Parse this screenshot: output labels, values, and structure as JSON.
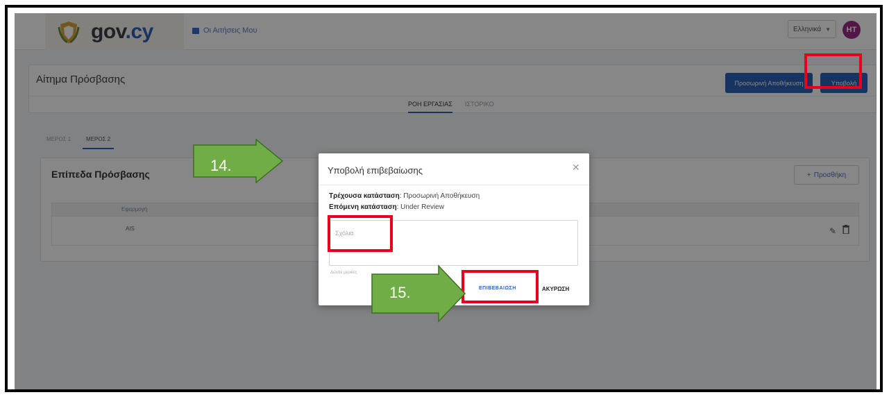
{
  "topnav": {
    "brand": "gov",
    "brand_suffix": ".cy",
    "nav_link": "Οι Αιτήσεις Μου",
    "language": "Ελληνικά",
    "avatar_initials": "HT"
  },
  "page": {
    "title": "Αίτημα Πρόσβασης",
    "save_button": "Προσωρινή Αποθήκευση",
    "submit_button": "Υποβολή",
    "tabs": [
      "ΡΟΗ ΕΡΓΑΣΙΑΣ",
      "ΙΣΤΟΡΙΚΟ"
    ],
    "subtabs": [
      "ΜΕΡΟΣ 1",
      "ΜΕΡΟΣ 2"
    ]
  },
  "access_levels": {
    "title": "Επίπεδα Πρόσβασης",
    "add_button": "Προσθήκη",
    "column_header": "Εφαρμογή",
    "rows": [
      {
        "application": "AIS"
      }
    ]
  },
  "modal": {
    "title": "Υποβολή επιβεβαίωσης",
    "current_state_label": "Τρέχουσα κατάσταση",
    "current_state_value": ": Προσωρινή Αποθήκευση",
    "next_state_label": "Επόμενη κατάσταση",
    "next_state_value": ": Under Review",
    "comments_placeholder": "Σχόλια",
    "hint": "Δώστε μερικές",
    "confirm_button": "ΕΠΙΒΕΒΑΙΩΣΗ",
    "cancel_button": "ΑΚΥΡΩΣΗ"
  },
  "annotations": {
    "step_14": "14.",
    "step_15": "15.",
    "highlight_color": "#e8001c",
    "callout_color": "#70ad47"
  }
}
